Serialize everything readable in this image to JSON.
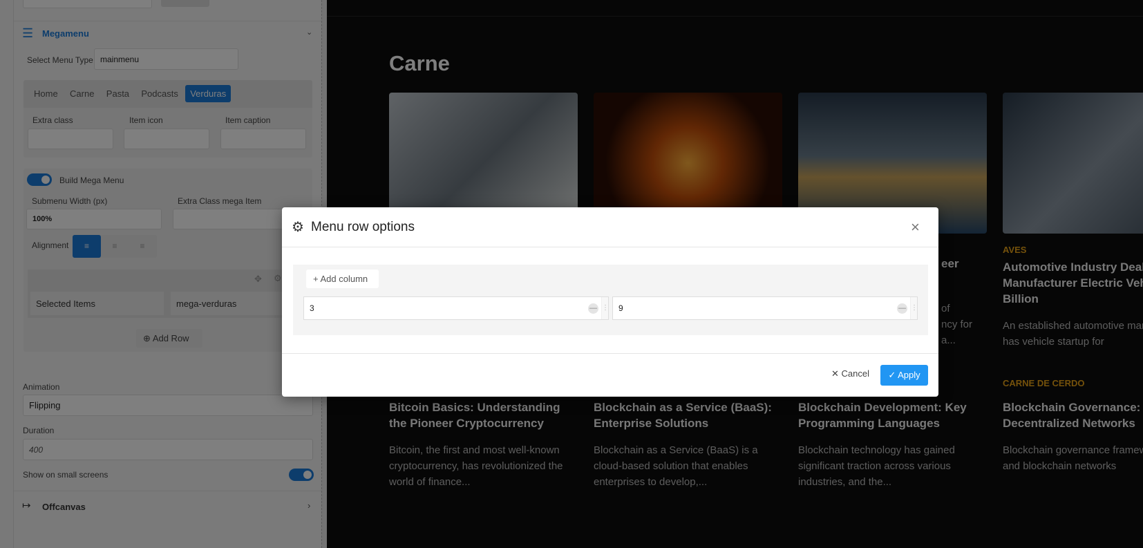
{
  "panel": {
    "megamenu_title": "Megamenu",
    "menu_type_label": "Select Menu Type",
    "menu_type_value": "mainmenu",
    "tabs": [
      "Home",
      "Carne",
      "Pasta",
      "Podcasts",
      "Verduras"
    ],
    "extra_class_label": "Extra class",
    "item_icon_label": "Item icon",
    "item_caption_label": "Item caption",
    "build_mega_label": "Build Mega Menu",
    "submenu_width_label": "Submenu Width (px)",
    "submenu_width_value": "100%",
    "extra_class_mega_label": "Extra Class mega Item",
    "alignment_label": "Alignment",
    "selected_items": "Selected Items",
    "mega_item": "mega-verduras",
    "add_row": "Add Row",
    "animation_label": "Animation",
    "animation_value": "Flipping",
    "duration_label": "Duration",
    "duration_value": "400",
    "small_screens_label": "Show on small screens",
    "offcanvas_title": "Offcanvas"
  },
  "site": {
    "heading": "Carne",
    "cards_row1": [
      {
        "cat": "",
        "title": "",
        "desc": ""
      },
      {
        "cat": "",
        "title": "eer",
        "desc": "of\nncy for\na..."
      },
      {
        "cat": "",
        "title": "",
        "desc": ""
      },
      {
        "cat": "AVES",
        "title": "Automotive Industry Deal as Manufacturer Electric Vehicle Billion",
        "desc": "An established automotive manufacturer has vehicle startup for"
      }
    ],
    "cards_row2": [
      {
        "cat": "",
        "title": "Bitcoin Basics: Understanding the Pioneer Cryptocurrency",
        "desc": "Bitcoin, the first and most well-known cryptocurrency, has revolutionized the world of finance..."
      },
      {
        "cat": "",
        "title": "Blockchain as a Service (BaaS): Enterprise Solutions",
        "desc": "Blockchain as a Service (BaaS) is a cloud-based solution that enables enterprises to develop,..."
      },
      {
        "cat": "",
        "title": "Blockchain Development: Key Programming Languages",
        "desc": "Blockchain technology has gained significant traction across various industries, and the..."
      },
      {
        "cat": "CARNE DE CERDO",
        "title": "Blockchain Governance: Decentralized Networks",
        "desc": "Blockchain governance frameworks and blockchain networks"
      }
    ]
  },
  "modal": {
    "title": "Menu row options",
    "add_column": "Add column",
    "columns": [
      "3",
      "9"
    ],
    "cancel": "Cancel",
    "apply": "Apply"
  },
  "colors": {
    "accent": "#1a7ad9",
    "apply": "#2196f3",
    "category": "#e8a317"
  }
}
